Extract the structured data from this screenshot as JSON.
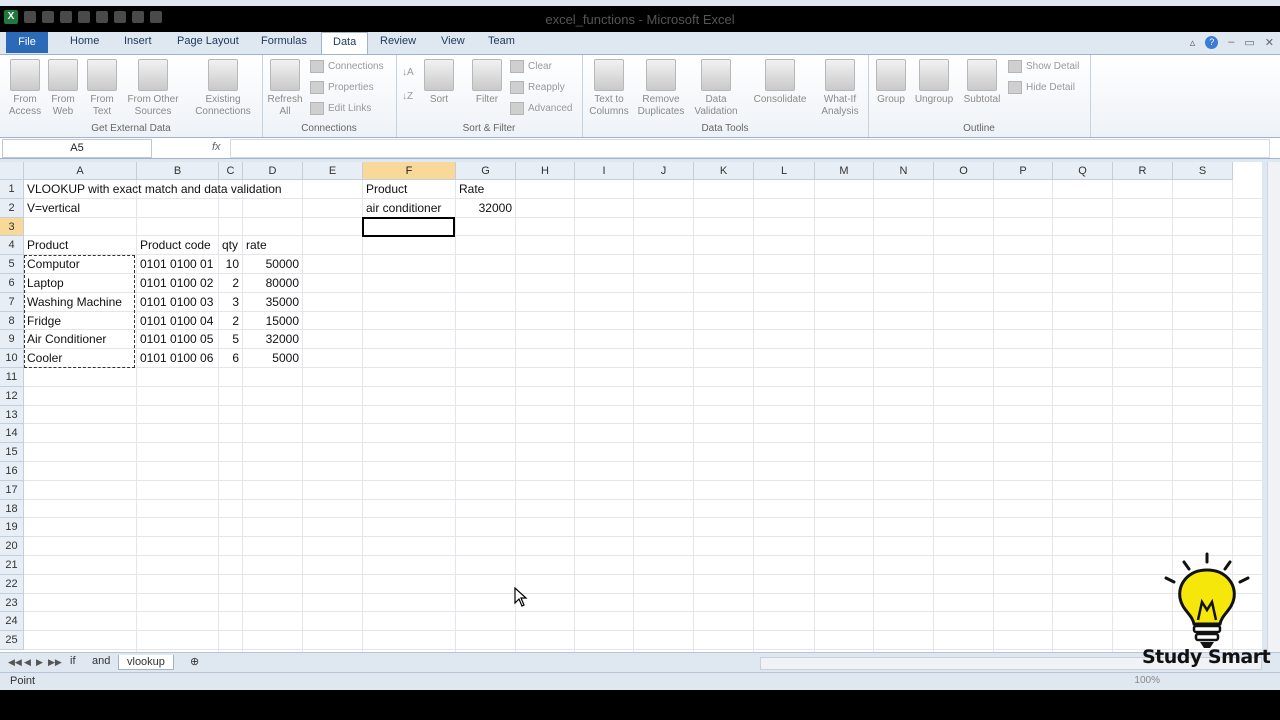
{
  "window": {
    "title": "excel_functions - Microsoft Excel"
  },
  "ribbon_tabs": [
    "File",
    "Home",
    "Insert",
    "Page Layout",
    "Formulas",
    "Data",
    "Review",
    "View",
    "Team"
  ],
  "ribbon": {
    "get_external_data": {
      "label": "Get External Data",
      "from_access": "From Access",
      "from_web": "From Web",
      "from_text": "From Text",
      "from_other": "From Other Sources",
      "existing": "Existing Connections"
    },
    "connections": {
      "label": "Connections",
      "refresh": "Refresh All",
      "connections": "Connections",
      "properties": "Properties",
      "edit_links": "Edit Links"
    },
    "sort_filter": {
      "label": "Sort & Filter",
      "sort": "Sort",
      "filter": "Filter",
      "clear": "Clear",
      "reapply": "Reapply",
      "advanced": "Advanced"
    },
    "data_tools": {
      "label": "Data Tools",
      "text_to_columns": "Text to Columns",
      "remove_duplicates": "Remove Duplicates",
      "data_validation": "Data Validation",
      "consolidate": "Consolidate",
      "what_if": "What-If Analysis"
    },
    "outline": {
      "label": "Outline",
      "group": "Group",
      "ungroup": "Ungroup",
      "subtotal": "Subtotal",
      "show_detail": "Show Detail",
      "hide_detail": "Hide Detail"
    }
  },
  "formula_bar": {
    "name_box": "A5",
    "fx": "fx",
    "formula": ""
  },
  "columns": [
    "A",
    "B",
    "C",
    "D",
    "E",
    "F",
    "G",
    "H",
    "I",
    "J",
    "K",
    "L",
    "M",
    "N",
    "O",
    "P",
    "Q",
    "R",
    "S"
  ],
  "rows": [
    "1",
    "2",
    "3",
    "4",
    "5",
    "6",
    "7",
    "8",
    "9",
    "10",
    "11",
    "12",
    "13",
    "14",
    "15",
    "16",
    "17",
    "18",
    "19",
    "20",
    "21",
    "22",
    "23",
    "24",
    "25"
  ],
  "cells": {
    "A1": "VLOOKUP with exact match and data validation",
    "A2": "V=vertical",
    "A4": "Product",
    "B4": "Product code",
    "C4": "qty",
    "D4": "rate",
    "F1": "Product",
    "G1": "Rate",
    "F2": "air conditioner",
    "G2": "32000"
  },
  "table": [
    {
      "product": "Computor",
      "code": "0101 0100 01",
      "qty": "10",
      "rate": "50000"
    },
    {
      "product": "Laptop",
      "code": "0101 0100 02",
      "qty": "2",
      "rate": "80000"
    },
    {
      "product": "Washing Machine",
      "code": "0101 0100 03",
      "qty": "3",
      "rate": "35000"
    },
    {
      "product": "Fridge",
      "code": "0101 0100 04",
      "qty": "2",
      "rate": "15000"
    },
    {
      "product": "Air Conditioner",
      "code": "0101 0100 05",
      "qty": "5",
      "rate": "32000"
    },
    {
      "product": "Cooler",
      "code": "0101 0100 06",
      "qty": "6",
      "rate": "5000"
    }
  ],
  "sheets": [
    "if",
    "and",
    "vlookup"
  ],
  "active_sheet": "vlookup",
  "status": {
    "mode": "Point",
    "zoom": "100%"
  },
  "watermark": {
    "text": "Study Smart"
  }
}
